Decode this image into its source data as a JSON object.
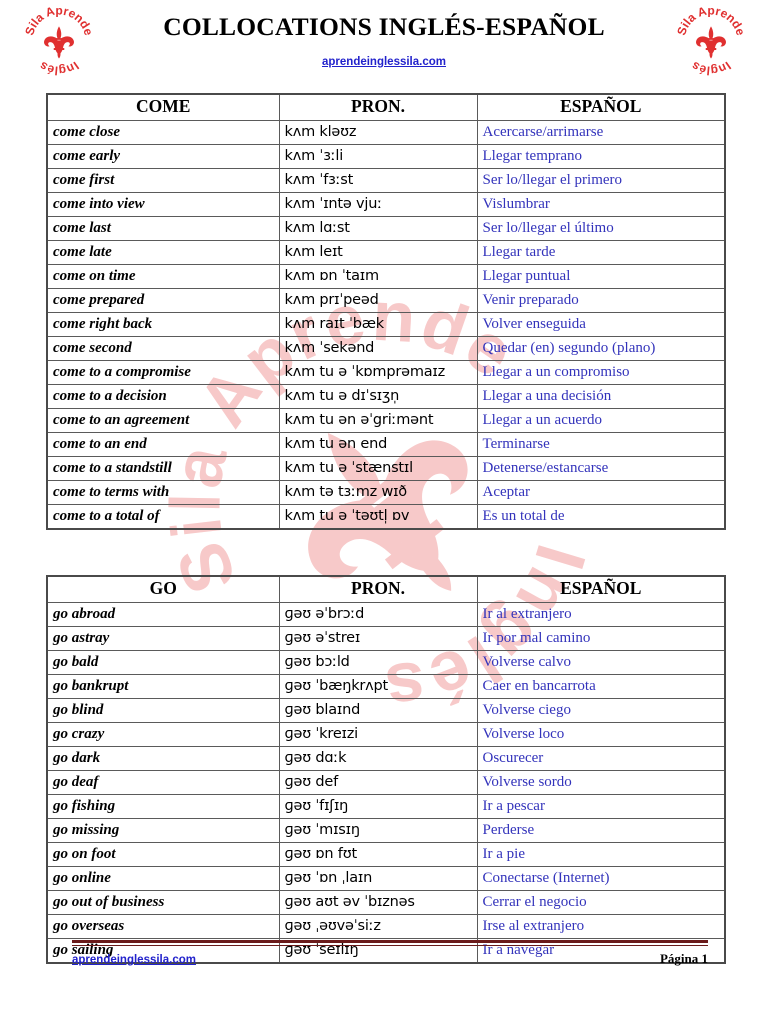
{
  "document": {
    "title": "COLLOCATIONS INGLÉS-ESPAÑOL",
    "site_link": "aprendeinglessila.com",
    "logo_text": "Sila Aprende Inglés",
    "brand_color": "#e03030",
    "link_color": "#2222cc",
    "spanish_color": "#3333bb",
    "rule_color": "#6b1b1b"
  },
  "footer": {
    "link": "aprendeinglessila.com",
    "page_label": "Página 1"
  },
  "tables": [
    {
      "id": "come",
      "headers": [
        "COME",
        "PRON.",
        "ESPAÑOL"
      ],
      "rows": [
        [
          "come close",
          "kʌm kləʊz",
          "Acercarse/arrimarse"
        ],
        [
          "come early",
          "kʌm ˈɜːli",
          "Llegar temprano"
        ],
        [
          "come first",
          "kʌm ˈfɜːst",
          "Ser lo/llegar el primero"
        ],
        [
          "come into view",
          "kʌm ˈɪntə vjuː",
          "Vislumbrar"
        ],
        [
          "come last",
          "kʌm lɑːst",
          "Ser lo/llegar el último"
        ],
        [
          "come late",
          "kʌm leɪt",
          "Llegar tarde"
        ],
        [
          "come on time",
          "kʌm ɒn ˈtaɪm",
          "Llegar puntual"
        ],
        [
          "come prepared",
          "kʌm prɪˈpeəd",
          "Venir preparado"
        ],
        [
          "come right back",
          "kʌm raɪt ˈbæk",
          "Volver enseguida"
        ],
        [
          "come second",
          "kʌm ˈsekənd",
          "Quedar (en) segundo (plano)"
        ],
        [
          "come to a compromise",
          "kʌm tu ə ˈkɒmprəmaɪz",
          "Llegar a un compromiso"
        ],
        [
          "come to a decision",
          "kʌm tu ə dɪˈsɪʒn̩",
          "Llegar a una decisión"
        ],
        [
          "come to an agreement",
          "kʌm tu ən əˈgriːmənt",
          "Llegar a un acuerdo"
        ],
        [
          "come to an end",
          "kʌm tu ən end",
          "Terminarse"
        ],
        [
          "come to a standstill",
          "kʌm tu ə ˈstænstɪl",
          "Detenerse/estancarse"
        ],
        [
          "come to terms with",
          "kʌm tə tɜːmz wɪð",
          "Aceptar"
        ],
        [
          "come to a total of",
          "kʌm tu ə ˈtəʊtl̩ ɒv",
          "Es un total de"
        ]
      ]
    },
    {
      "id": "go",
      "headers": [
        "GO",
        "PRON.",
        "ESPAÑOL"
      ],
      "rows": [
        [
          "go abroad",
          "ɡəʊ əˈbrɔːd",
          "Ir al extranjero"
        ],
        [
          "go astray",
          "ɡəʊ əˈstreɪ",
          "Ir por mal camino"
        ],
        [
          "go bald",
          "ɡəʊ bɔːld",
          "Volverse calvo"
        ],
        [
          "go bankrupt",
          "ɡəʊ ˈbæŋkrʌpt",
          "Caer en bancarrota"
        ],
        [
          "go blind",
          "ɡəʊ blaɪnd",
          "Volverse ciego"
        ],
        [
          "go crazy",
          "ɡəʊ ˈkreɪzi",
          "Volverse loco"
        ],
        [
          "go dark",
          "ɡəʊ dɑːk",
          "Oscurecer"
        ],
        [
          "go deaf",
          "ɡəʊ def",
          "Volverse sordo"
        ],
        [
          "go fishing",
          "ɡəʊ ˈfɪʃɪŋ",
          "Ir a pescar"
        ],
        [
          "go missing",
          "ɡəʊ ˈmɪsɪŋ",
          "Perderse"
        ],
        [
          "go on foot",
          "ɡəʊ ɒn fʊt",
          "Ir a pie"
        ],
        [
          "go online",
          "ɡəʊ ˈɒn ˌlaɪn",
          "Conectarse (Internet)"
        ],
        [
          "go out of business",
          "ɡəʊ aʊt əv ˈbɪznəs",
          "Cerrar el negocio"
        ],
        [
          "go overseas",
          "ɡəʊ ˌəʊvəˈsiːz",
          "Irse al extranjero"
        ],
        [
          "go sailing",
          "ɡəʊ ˈseɪlɪŋ",
          "Ir a navegar"
        ]
      ]
    }
  ]
}
